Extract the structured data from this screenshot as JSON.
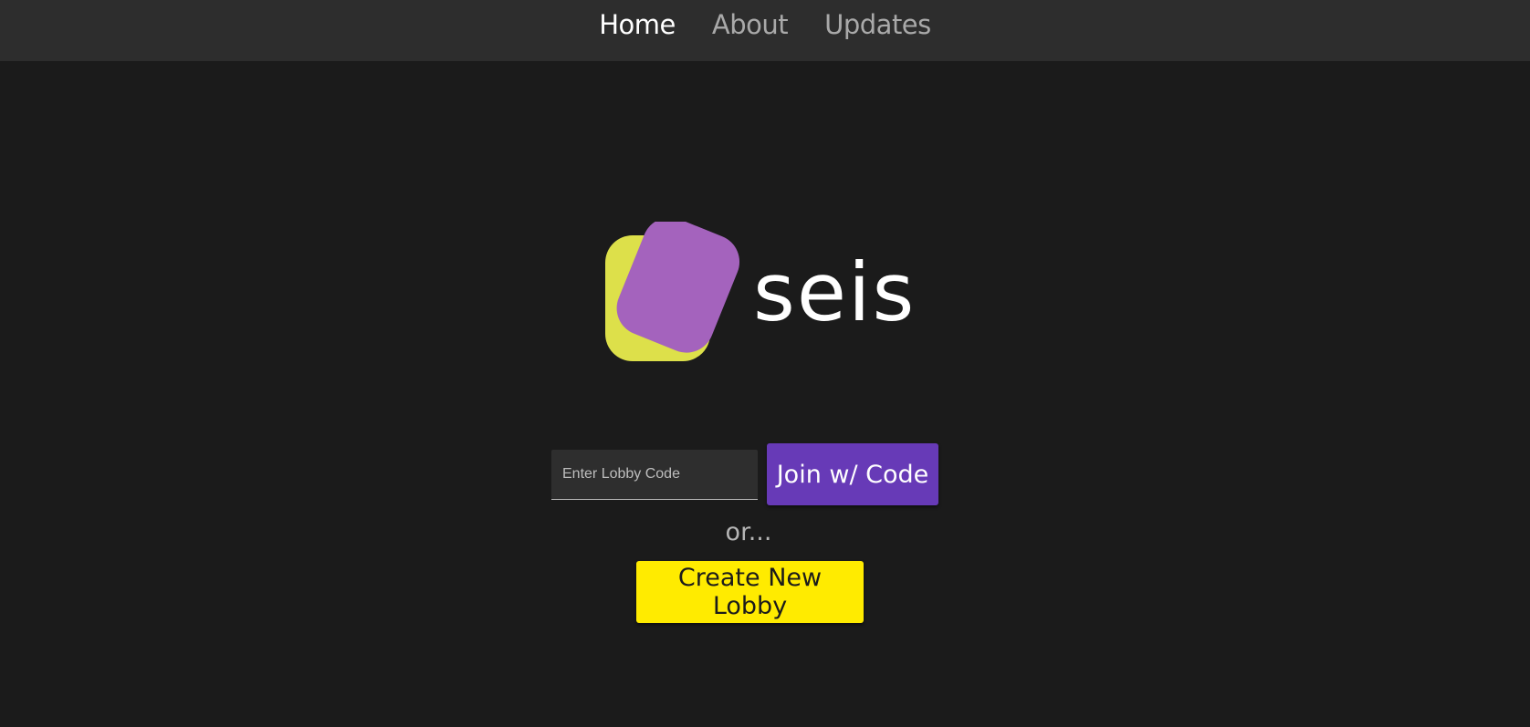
{
  "nav": {
    "items": [
      {
        "label": "Home",
        "active": true
      },
      {
        "label": "About",
        "active": false
      },
      {
        "label": "Updates",
        "active": false
      }
    ]
  },
  "logo": {
    "wordmark": "seis",
    "colors": {
      "yellow": "#dde04a",
      "purple": "#a463bd"
    }
  },
  "join": {
    "placeholder": "Enter Lobby Code",
    "value": "",
    "button_label": "Join w/ Code",
    "button_color": "#673ab7"
  },
  "separator": "or...",
  "create": {
    "button_label": "Create New Lobby",
    "button_color": "#ffeb00"
  },
  "colors": {
    "background": "#1b1b1b",
    "navbar": "#2d2d2d"
  }
}
